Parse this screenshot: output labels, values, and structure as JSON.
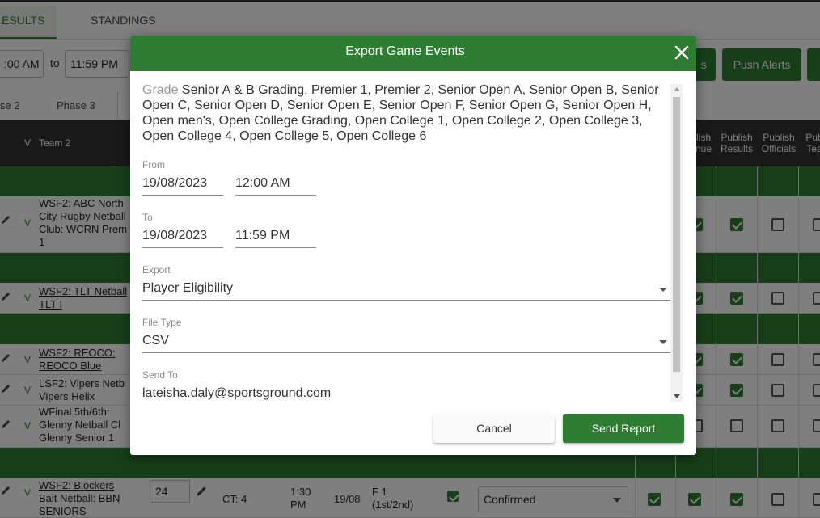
{
  "background": {
    "tabs": {
      "results": "ESULTS",
      "standings": "STANDINGS"
    },
    "time_filter": {
      "from_time": ":00 AM",
      "to_label": "to",
      "to_time": "11:59 PM"
    },
    "action_buttons": {
      "partial": "s",
      "push_alerts": "Push Alerts"
    },
    "phases": {
      "phase2": "se 2",
      "phase3": "Phase 3"
    },
    "table": {
      "col_v": "V",
      "col_team2": "Team 2",
      "col_publish_venue": "lish\nnue",
      "col_publish_results": "Publish\nResults",
      "col_publish_officials": "Publish\nOfficials",
      "col_publish_teams": "Pub\nTea",
      "rows": [
        {
          "team2": "WSF2: ABC North City Rugby Netball Club: WCRN Prem 1",
          "v": "V"
        },
        {
          "team2": "WSF2: TLT Netball TLT I",
          "v": "V"
        },
        {
          "team2": "WSF2: REOCO: REOCO Blue",
          "v": "V"
        },
        {
          "team2": "LSF2: Vipers Netb Vipers Helix",
          "v": "V"
        },
        {
          "team2": "WFinal 5th/6th: Glenny  Netball Cl Glenny  Senior 1",
          "v": "V"
        },
        {
          "team2": "WSF2: Blockers Bait Netball: BBN SENIORS",
          "v": "V",
          "number": "24",
          "court": "CT: 4",
          "time": "1:30 PM",
          "date": "19/08",
          "round": "F 1 (1st/2nd)",
          "status": "Confirmed"
        }
      ]
    }
  },
  "modal": {
    "title": "Export Game Events",
    "grade_label": "Grade",
    "grade_value": "Senior A & B Grading, Premier 1, Premier 2, Senior Open A, Senior Open B, Senior Open C, Senior Open D, Senior Open E, Senior Open F, Senior Open G, Senior Open H, Open men's, Open College Grading, Open College 1, Open College 2, Open College 3, Open College 4, Open College 5, Open College 6",
    "from_label": "From",
    "from_date": "19/08/2023",
    "from_time": "12:00 AM",
    "to_label": "To",
    "to_date": "19/08/2023",
    "to_time": "11:59 PM",
    "export_label": "Export",
    "export_value": "Player Eligibility",
    "filetype_label": "File Type",
    "filetype_value": "CSV",
    "sendto_label": "Send To",
    "sendto_value": "lateisha.daly@sportsground.com",
    "cancel_label": "Cancel",
    "send_label": "Send Report"
  },
  "colors": {
    "primary": "#2e7d32",
    "header_dark": "#333333"
  },
  "icons": [
    "close-icon",
    "pencil-icon",
    "checkbox-icon",
    "dropdown-caret-icon"
  ]
}
